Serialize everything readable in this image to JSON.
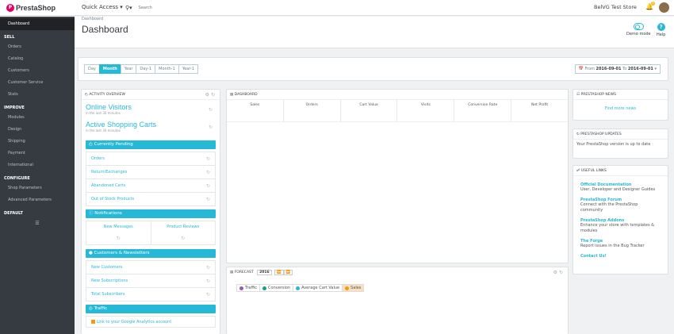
{
  "topbar": {
    "logo_text": "PrestaShop",
    "quick_access": "Quick Access",
    "search_placeholder": "Search",
    "store_name": "BelVG Test Store",
    "notification_count": "1"
  },
  "sidebar": {
    "dashboard": "Dashboard",
    "sections": [
      {
        "title": "SELL",
        "items": [
          "Orders",
          "Catalog",
          "Customers",
          "Customer Service",
          "Stats"
        ]
      },
      {
        "title": "IMPROVE",
        "items": [
          "Modules",
          "Design",
          "Shipping",
          "Payment",
          "International"
        ]
      },
      {
        "title": "CONFIGURE",
        "items": [
          "Shop Parameters",
          "Advanced Parameters"
        ]
      },
      {
        "title": "DEFAULT",
        "items": []
      }
    ]
  },
  "header": {
    "breadcrumb": "Dashboard",
    "title": "Dashboard",
    "demo_mode": "Demo mode",
    "help": "Help"
  },
  "filter": {
    "periods": [
      "Day",
      "Month",
      "Year",
      "Day-1",
      "Month-1",
      "Year-1"
    ],
    "active_period": "Month",
    "from_label": "From",
    "from_date": "2016-09-01",
    "to_label": "To",
    "to_date": "2016-09-01"
  },
  "activity": {
    "title": "Activity overview",
    "online_visitors": "Online Visitors",
    "online_note": "in the last 30 minutes",
    "active_carts": "Active Shopping Carts",
    "carts_note": "in the last 30 minutes",
    "pending_title": "Currently Pending",
    "pending_items": [
      "Orders",
      "Return/Exchanges",
      "Abandoned Carts",
      "Out of Stock Products"
    ],
    "notifications_title": "Notifications",
    "notifications_items": [
      "New Messages",
      "Product Reviews"
    ],
    "customers_title": "Customers & Newsletters",
    "customers_items": [
      "New Customers",
      "New Subscriptions",
      "Total Subscribers"
    ],
    "traffic_title": "Traffic",
    "traffic_link": "Link to your Google Analytics account"
  },
  "dashboard_panel": {
    "title": "Dashboard",
    "columns": [
      "Sales",
      "Orders",
      "Cart Value",
      "Visits",
      "Conversion Rate",
      "Net Profit"
    ]
  },
  "forecast": {
    "title": "Forecast",
    "year": "2016",
    "legend": [
      {
        "label": "Traffic",
        "color": "#9b59b6"
      },
      {
        "label": "Conversion",
        "color": "#16a085"
      },
      {
        "label": "Average Cart Value",
        "color": "#25b9d7"
      },
      {
        "label": "Sales",
        "color": "#f39c12"
      }
    ]
  },
  "news": {
    "title": "PrestaShop News",
    "link": "Find more news"
  },
  "updates": {
    "title": "PrestaShop Updates",
    "text": "Your PrestaShop version is up to date"
  },
  "useful_links": {
    "title": "Useful Links",
    "items": [
      {
        "title": "Official Documentation",
        "desc": "User, Developer and Designer Guides"
      },
      {
        "title": "PrestaShop Forum",
        "desc": "Connect with the PrestaShop community"
      },
      {
        "title": "PrestaShop Addons",
        "desc": "Enhance your store with templates & modules"
      },
      {
        "title": "The Forge",
        "desc": "Report issues in the Bug Tracker"
      },
      {
        "title": "Contact Us!",
        "desc": ""
      }
    ]
  }
}
